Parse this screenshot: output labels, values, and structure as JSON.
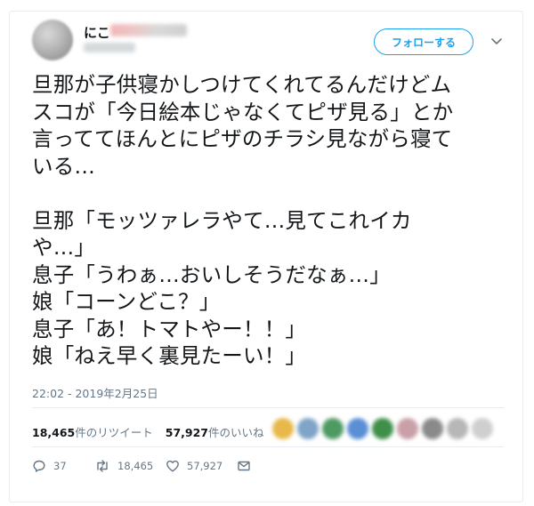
{
  "user": {
    "display_name": "にこ",
    "avatar": "blurred-avatar"
  },
  "follow_button": {
    "label": "フォローする"
  },
  "tweet": {
    "lines": [
      "旦那が子供寝かしつけてくれてるんだけどム",
      "スコが「今日絵本じゃなくてピザ見る」とか",
      "言っててほんとにピザのチラシ見ながら寝て",
      "いる…",
      "",
      "旦那「モッツァレラやて…見てこれイカ",
      "や…」",
      "息子「うわぁ…おいしそうだなぁ…」",
      "娘「コーンどこ？」",
      "息子「あ！トマトやー！！」",
      "娘「ねえ早く裏見たーい！」"
    ],
    "timestamp": "22:02 - 2019年2月25日"
  },
  "stats": {
    "retweet_count": "18,465",
    "retweet_label": "件のリツイート",
    "like_count": "57,927",
    "like_label": "件のいいね"
  },
  "actions": {
    "reply_count": "37",
    "retweet_count": "18,465",
    "like_count": "57,927"
  },
  "colors": {
    "accent": "#1da1f2",
    "secondary_text": "#657786",
    "border": "#e6ecf0"
  }
}
